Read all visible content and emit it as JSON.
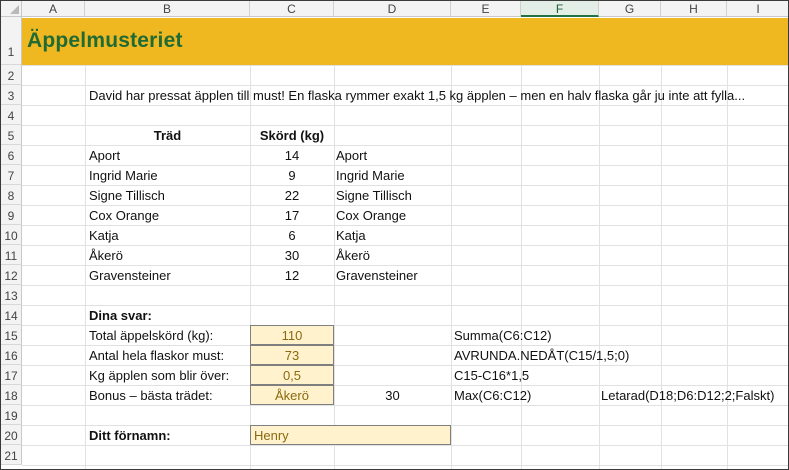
{
  "columns": [
    "A",
    "B",
    "C",
    "D",
    "E",
    "F",
    "G",
    "H",
    "I"
  ],
  "rows": [
    "1",
    "2",
    "3",
    "4",
    "5",
    "6",
    "7",
    "8",
    "9",
    "10",
    "11",
    "12",
    "13",
    "14",
    "15",
    "16",
    "17",
    "18",
    "19",
    "20",
    "21"
  ],
  "title": "Äppelmusteriet",
  "intro": "David har pressat äpplen till must! En flaska rymmer exakt 1,5 kg äpplen – men en halv flaska går ju inte att fylla...",
  "table": {
    "header_tree": "Träd",
    "header_yield": "Skörd (kg)",
    "rows": [
      {
        "name": "Aport",
        "kg": "14",
        "lookup": "Aport"
      },
      {
        "name": "Ingrid Marie",
        "kg": "9",
        "lookup": "Ingrid Marie"
      },
      {
        "name": "Signe Tillisch",
        "kg": "22",
        "lookup": "Signe Tillisch"
      },
      {
        "name": "Cox Orange",
        "kg": "17",
        "lookup": "Cox Orange"
      },
      {
        "name": "Katja",
        "kg": "6",
        "lookup": "Katja"
      },
      {
        "name": "Åkerö",
        "kg": "30",
        "lookup": "Åkerö"
      },
      {
        "name": "Gravensteiner",
        "kg": "12",
        "lookup": "Gravensteiner"
      }
    ]
  },
  "answers": {
    "heading": "Dina svar:",
    "total_label": "Total äppelskörd (kg):",
    "total_value": "110",
    "total_formula": "Summa(C6:C12)",
    "bottles_label": "Antal hela flaskor must:",
    "bottles_value": "73",
    "bottles_formula": "AVRUNDA.NEDÅT(C15/1,5;0)",
    "left_label": "Kg äpplen som blir över:",
    "left_value": "0,5",
    "left_formula": "C15-C16*1,5",
    "bonus_label": "Bonus – bästa trädet:",
    "bonus_value": "Åkerö",
    "bonus_max": "30",
    "bonus_max_formula": "Max(C6:C12)",
    "bonus_lookup_formula": "Letarad(D18;D6:D12;2;Falskt)"
  },
  "name": {
    "label": "Ditt förnamn:",
    "value": "Henry"
  },
  "colors": {
    "title_band": "#f0b820",
    "title_text": "#1f6a35",
    "input_fill": "#fff2cc",
    "selected_header": "#217346"
  }
}
